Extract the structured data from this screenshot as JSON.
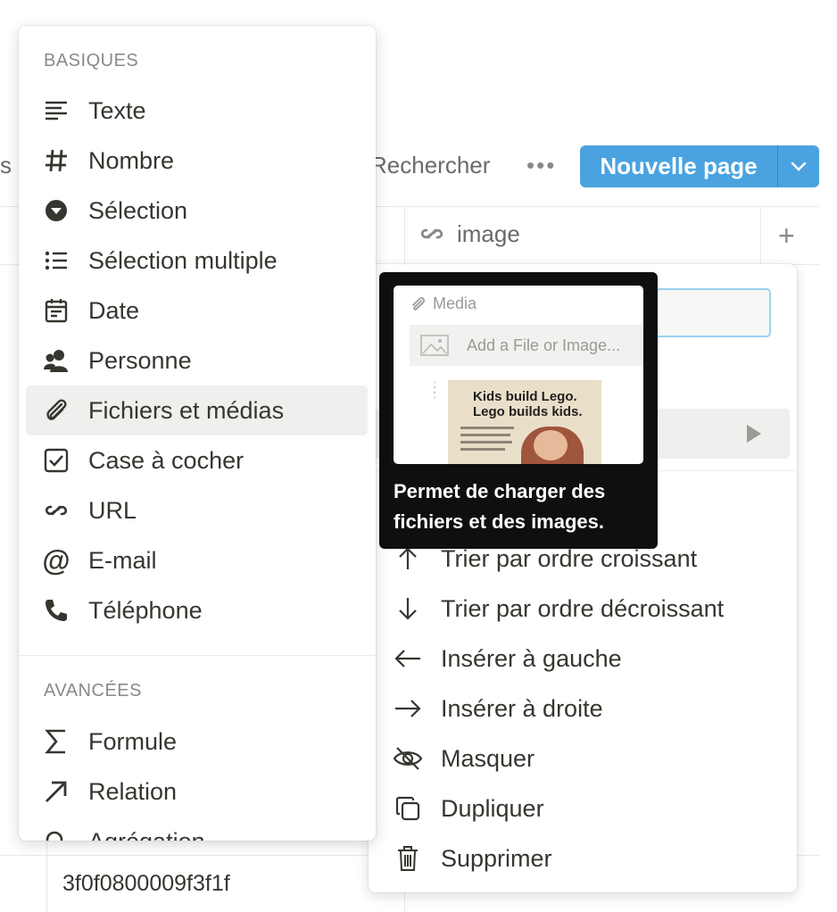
{
  "toolbar": {
    "left_fragment": "s",
    "search_label": "Rechercher",
    "more_label": "•••",
    "new_page_label": "Nouvelle page"
  },
  "table": {
    "column_header": "image",
    "add_column": "+",
    "cell_value": "3f0f0800009f3f1f"
  },
  "type_menu": {
    "basic_label": "BASIQUES",
    "items": [
      {
        "label": "Texte",
        "icon": "text-icon"
      },
      {
        "label": "Nombre",
        "icon": "hash-icon"
      },
      {
        "label": "Sélection",
        "icon": "select-icon"
      },
      {
        "label": "Sélection multiple",
        "icon": "multi-select-icon"
      },
      {
        "label": "Date",
        "icon": "calendar-icon"
      },
      {
        "label": "Personne",
        "icon": "person-icon"
      },
      {
        "label": "Fichiers et médias",
        "icon": "paperclip-icon"
      },
      {
        "label": "Case à cocher",
        "icon": "checkbox-icon"
      },
      {
        "label": "URL",
        "icon": "link-icon"
      },
      {
        "label": "E-mail",
        "icon": "at-icon"
      },
      {
        "label": "Téléphone",
        "icon": "phone-icon"
      }
    ],
    "advanced_label": "AVANCÉES",
    "advanced_items": [
      {
        "label": "Formule",
        "icon": "sigma-icon"
      },
      {
        "label": "Relation",
        "icon": "arrow-up-right-icon"
      },
      {
        "label": "Agrégation",
        "icon": "search-icon"
      }
    ],
    "selected": "Fichiers et médias"
  },
  "tooltip": {
    "preview_header": "Media",
    "preview_add": "Add a File or Image...",
    "preview_ad_line1": "Kids build Lego.",
    "preview_ad_line2": "Lego builds kids.",
    "description": "Permet de charger des fichiers et des images."
  },
  "column_menu": {
    "items": [
      {
        "label": "Trier par ordre croissant",
        "icon": "arrow-up-icon"
      },
      {
        "label": "Trier par ordre décroissant",
        "icon": "arrow-down-icon"
      },
      {
        "label": "Insérer à gauche",
        "icon": "arrow-left-icon"
      },
      {
        "label": "Insérer à droite",
        "icon": "arrow-right-icon"
      },
      {
        "label": "Masquer",
        "icon": "eye-off-icon"
      },
      {
        "label": "Dupliquer",
        "icon": "duplicate-icon"
      },
      {
        "label": "Supprimer",
        "icon": "trash-icon"
      }
    ]
  },
  "colors": {
    "accent": "#4aa3e0",
    "selected_row": "#efefed",
    "tooltip_bg": "#0f0f0f"
  }
}
